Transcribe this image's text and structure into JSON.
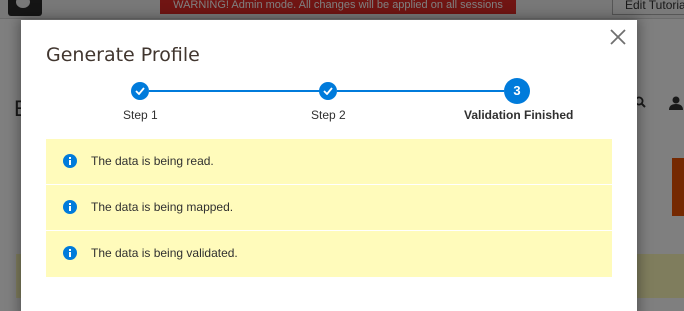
{
  "background": {
    "warning_banner": "WARNING! Admin mode. All changes will be applied on all sessions",
    "edit_button_label": "Edit Tutorial",
    "heading_initial": "E"
  },
  "modal": {
    "title": "Generate Profile",
    "close_icon": "close-icon",
    "steps": [
      {
        "label": "Step 1",
        "number": "1",
        "state": "complete"
      },
      {
        "label": "Step 2",
        "number": "2",
        "state": "complete"
      },
      {
        "label": "Validation Finished",
        "number": "3",
        "state": "active"
      }
    ],
    "messages": [
      {
        "text": "The data is being read.",
        "icon": "info-icon"
      },
      {
        "text": "The data is being mapped.",
        "icon": "info-icon"
      },
      {
        "text": "The data is being validated.",
        "icon": "info-icon"
      }
    ]
  },
  "colors": {
    "accent": "#007bdb",
    "message_background": "#fffbbb",
    "warning": "#e02b27",
    "title_text": "#41362f"
  }
}
